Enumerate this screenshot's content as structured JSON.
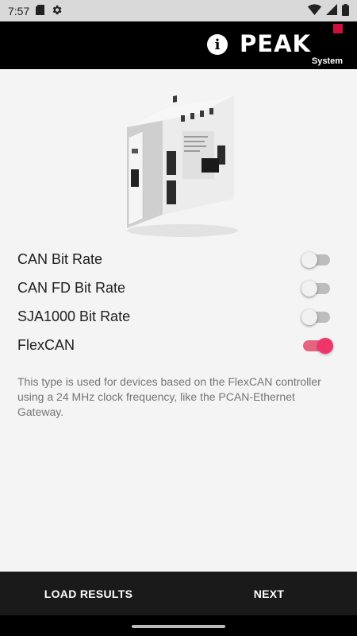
{
  "status_bar": {
    "time": "7:57",
    "icons_left": [
      "sd-card-icon",
      "settings-gear-icon"
    ],
    "icons_right": [
      "wifi-icon",
      "signal-icon",
      "battery-icon"
    ]
  },
  "header": {
    "info_label": "i",
    "logo_text": "PEAK",
    "logo_subtext": "System",
    "accent_color": "#d0103a"
  },
  "options": [
    {
      "label": "CAN Bit Rate",
      "enabled": false
    },
    {
      "label": "CAN FD Bit Rate",
      "enabled": false
    },
    {
      "label": "SJA1000 Bit Rate",
      "enabled": false
    },
    {
      "label": "FlexCAN",
      "enabled": true
    }
  ],
  "description": "This type is used for devices based on the FlexCAN controller using a 24 MHz clock frequency, like the PCAN-Ethernet Gateway.",
  "bottom_bar": {
    "load_results_label": "LOAD RESULTS",
    "next_label": "NEXT"
  },
  "colors": {
    "toggle_on": "#f0356b",
    "toggle_off": "#bdbdbd"
  }
}
